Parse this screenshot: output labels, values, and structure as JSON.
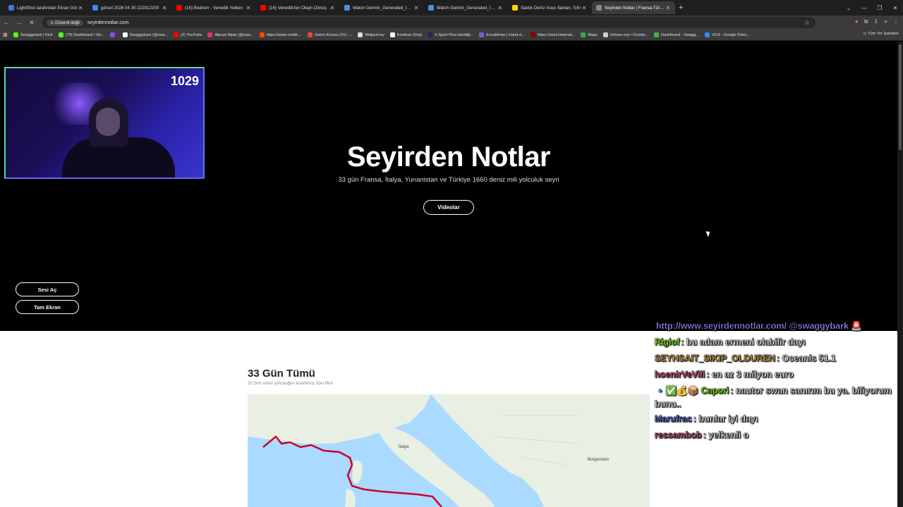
{
  "browser": {
    "tabs": [
      {
        "title": "LightShot tarafından Ekran Gör",
        "color": "#3b78e7",
        "active": false
      },
      {
        "title": "görsel 2026 04 30 222912200",
        "color": "#4285f4",
        "active": false
      },
      {
        "title": "(16) Bodrum - Venedik Yelken",
        "color": "#ff0000",
        "active": false
      },
      {
        "title": "(16) Venedik'ten Olaylı Dönüş",
        "color": "#ff0000",
        "active": false
      },
      {
        "title": "Watch Gemini_Generated_Imag",
        "color": "#4a90d9",
        "active": false
      },
      {
        "title": "Watch Gemini_Generated_Imag",
        "color": "#4a90d9",
        "active": false
      },
      {
        "title": "Satılık Deniz Aracı İlanları, Sıfır",
        "color": "#ffd600",
        "active": false
      },
      {
        "title": "Seyirden Notlar | Fransa-Türkiye",
        "color": "#888888",
        "active": true
      }
    ],
    "new_tab": "+",
    "security_label": "Güvenli değil",
    "url": "seyirdennotlar.com",
    "bookmarks": [
      {
        "label": "Swaggybark | Kick",
        "color": "#53fc18"
      },
      {
        "label": "(79) Dashboard / Str...",
        "color": "#53fc18"
      },
      {
        "label": "",
        "color": "#9146ff"
      },
      {
        "label": "Swaggybark (@swa...",
        "color": "#ffffff"
      },
      {
        "label": "(2) YouTube",
        "color": "#ff0000"
      },
      {
        "label": "Alpcan Alpar (@swa...",
        "color": "#e1306c"
      },
      {
        "label": "https://www.reddit....",
        "color": "#ff4500"
      },
      {
        "label": "Gelen Kutusu (31) -...",
        "color": "#ea4335"
      },
      {
        "label": "Midjourney",
        "color": "#dddddd"
      },
      {
        "label": "Konfuse Shop",
        "color": "#ffffff"
      },
      {
        "label": "S Sport Plus-İstediği...",
        "color": "#1e2a5a"
      },
      {
        "label": "Excalidraw | Hand-d...",
        "color": "#6965db"
      },
      {
        "label": "https://next.inkarnat...",
        "color": "#8b0000"
      },
      {
        "label": "Maps",
        "color": "#34a853"
      },
      {
        "label": "lichess.org • Ücretsi...",
        "color": "#cccccc"
      },
      {
        "label": "Dashboard - Swagg...",
        "color": "#4caf50"
      },
      {
        "label": "V0.8 - Google Dokü...",
        "color": "#4285f4"
      }
    ],
    "all_bookmarks": "Tüm Yer İşaretleri"
  },
  "stream": {
    "viewer_count": "1029"
  },
  "hero": {
    "title": "Seyirden Notlar",
    "subtitle": "33 gün Fransa, İtalya, Yunanistan ve Türkiye 1660 deniz mili yolculuk seyri",
    "videos_button": "Videolar",
    "sound_button": "Sesi Aç",
    "fullscreen_button": "Tam Ekran"
  },
  "section": {
    "title": "33 Gün Tümü",
    "subtitle": "33 Gün süren yolculuğun kısaltılmış özet filmi.",
    "map_labels": {
      "italy": "İtalya",
      "bulgaria": "Bulgaristan"
    }
  },
  "chat": [
    {
      "user": "",
      "text": "http://www.seyirdennotlar.com/ @swaggybark 🚨",
      "color": "#9b8cff"
    },
    {
      "user": "Rigiof",
      "text": ": bu adam ermeni olabilir dayı",
      "color": "#7cfc00"
    },
    {
      "user": "SEYHSAIT_SIKIP_OLDUREN",
      "text": ": Oceanis 51.1",
      "color": "#d2a04a"
    },
    {
      "user": "hoenirVeVili",
      "text": ": en az 3 milyon euro",
      "color": "#d65a7a"
    },
    {
      "user": "🔹✅💰📦 Capori",
      "text": ": nautor swan sanırım bu ya. biliyorum bunu..",
      "color": "#7cfc00"
    },
    {
      "user": "Marufrac",
      "text": ": bunlar iyi dayı",
      "color": "#5a7ce0"
    },
    {
      "user": "ressambob",
      "text": ": yelkenli o",
      "color": "#d65a7a"
    }
  ]
}
